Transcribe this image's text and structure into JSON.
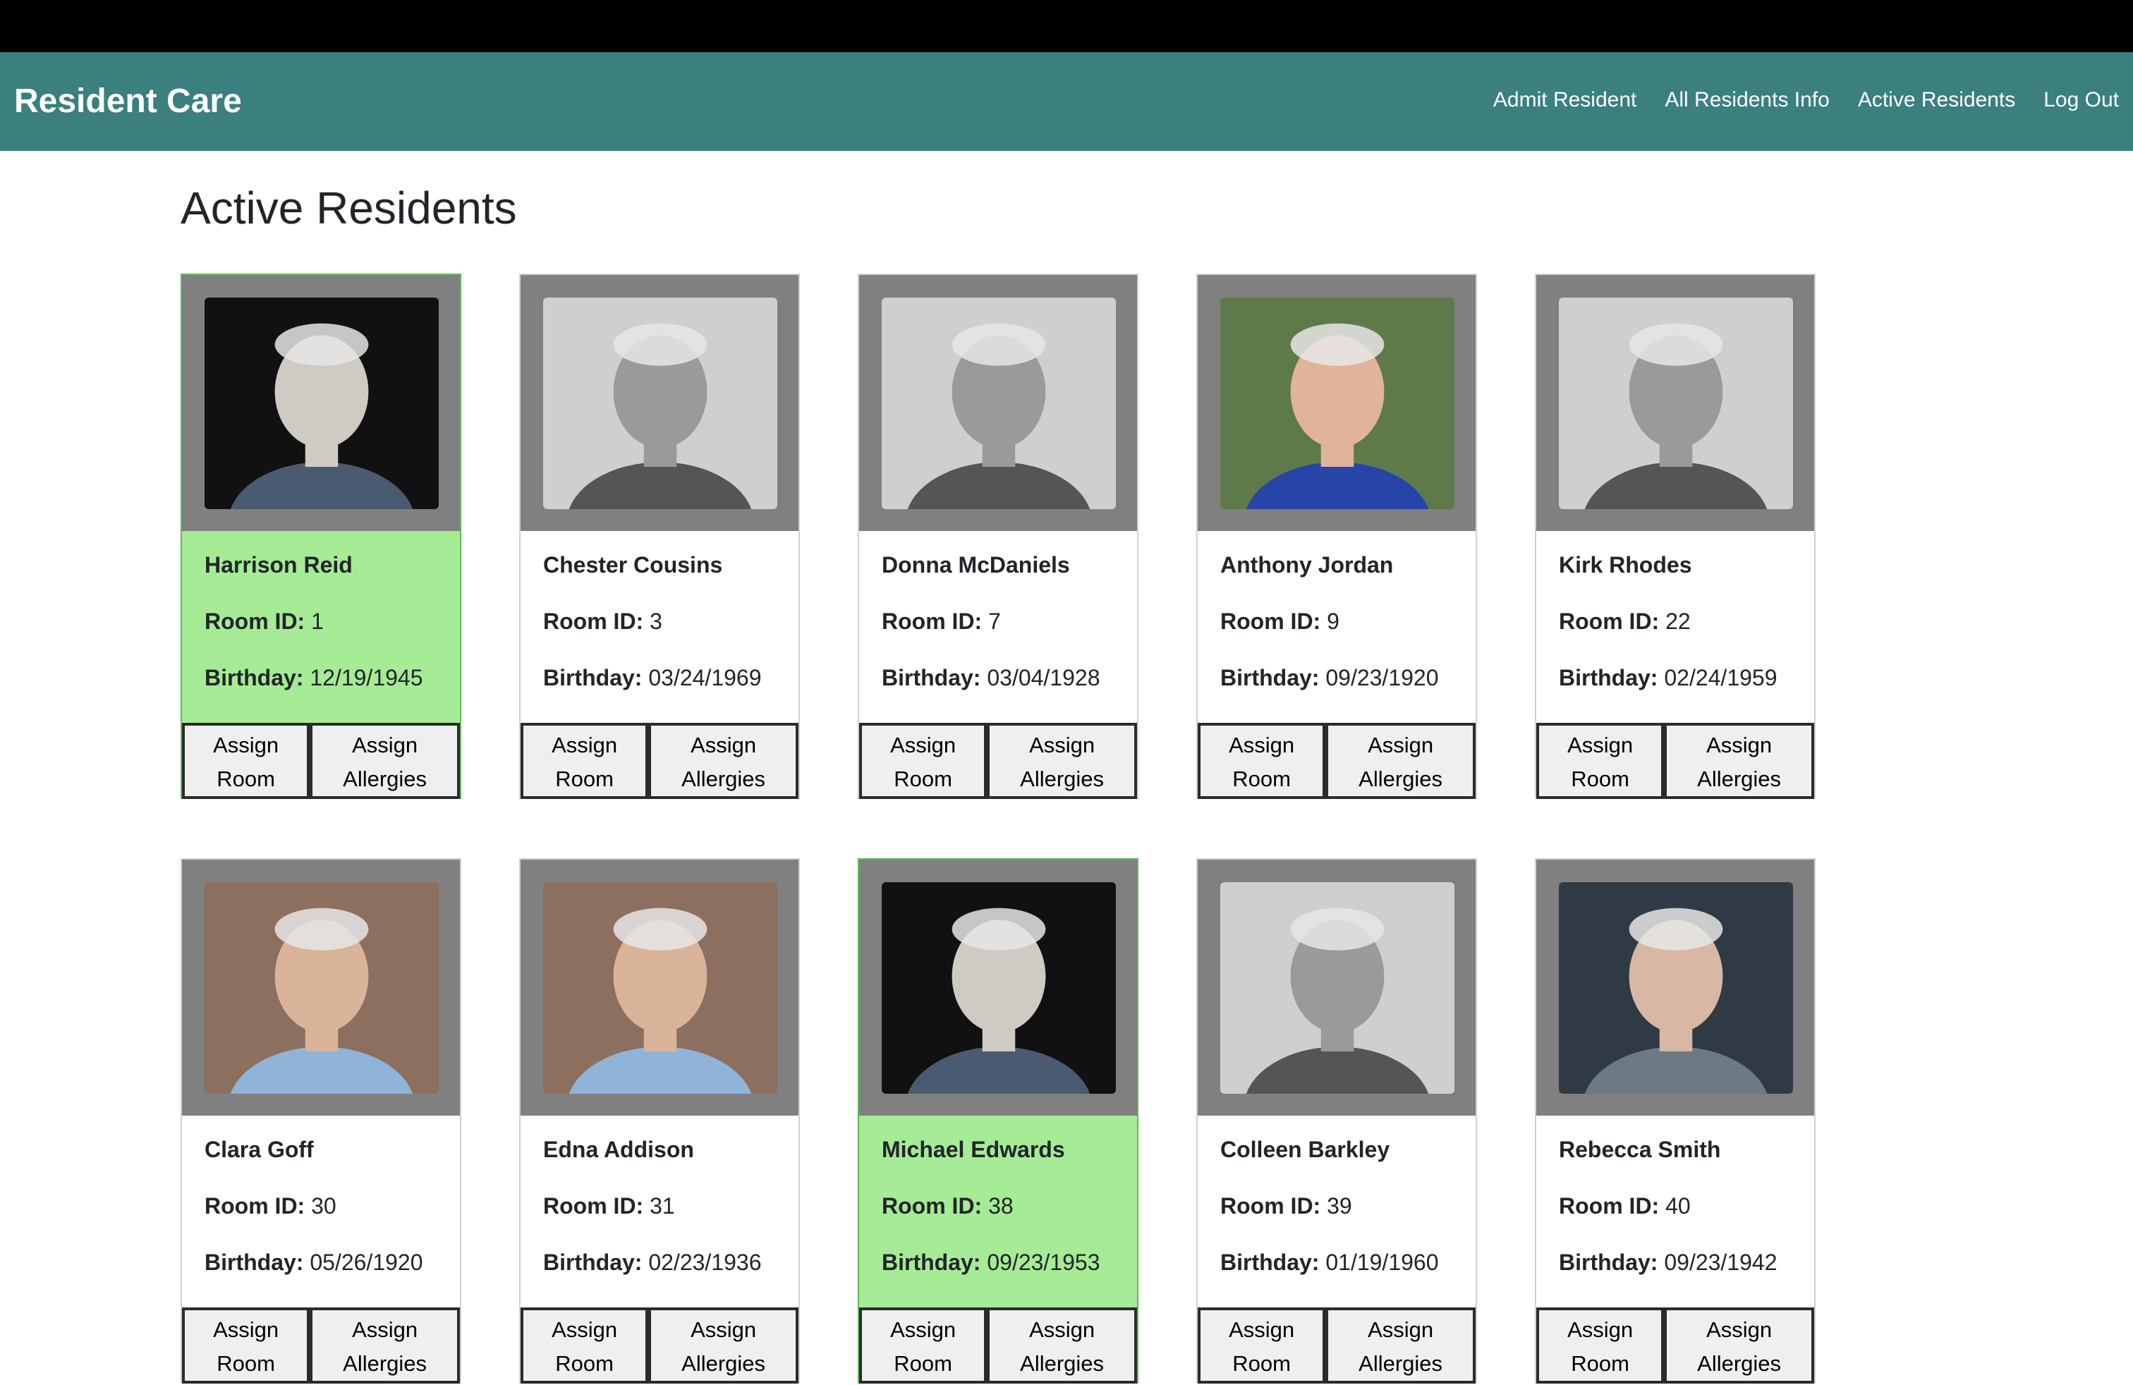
{
  "app": {
    "brand": "Resident Care"
  },
  "nav": {
    "items": [
      {
        "label": "Admit Resident"
      },
      {
        "label": "All Residents Info"
      },
      {
        "label": "Active Residents"
      },
      {
        "label": "Log Out"
      }
    ]
  },
  "page": {
    "title": "Active Residents"
  },
  "labels": {
    "room_id": "Room ID:",
    "birthday": "Birthday:",
    "assign_room": "Assign Room",
    "assign_allergies": "Assign Allergies"
  },
  "colors": {
    "navbar": "#3b7f7f",
    "active_card_bg": "#a6eb95",
    "photo_frame": "#808080"
  },
  "residents": [
    {
      "name": "Harrison Reid",
      "room_id": "1",
      "birthday": "12/19/1945",
      "highlighted": true,
      "photo": "portrait-dark"
    },
    {
      "name": "Chester Cousins",
      "room_id": "3",
      "birthday": "03/24/1969",
      "highlighted": false,
      "photo": "portrait-grey"
    },
    {
      "name": "Donna McDaniels",
      "room_id": "7",
      "birthday": "03/04/1928",
      "highlighted": false,
      "photo": "portrait-grey"
    },
    {
      "name": "Anthony Jordan",
      "room_id": "9",
      "birthday": "09/23/1920",
      "highlighted": false,
      "photo": "portrait-blue"
    },
    {
      "name": "Kirk Rhodes",
      "room_id": "22",
      "birthday": "02/24/1959",
      "highlighted": false,
      "photo": "portrait-grey"
    },
    {
      "name": "Clara Goff",
      "room_id": "30",
      "birthday": "05/26/1920",
      "highlighted": false,
      "photo": "portrait-warm"
    },
    {
      "name": "Edna Addison",
      "room_id": "31",
      "birthday": "02/23/1936",
      "highlighted": false,
      "photo": "portrait-warm"
    },
    {
      "name": "Michael Edwards",
      "room_id": "38",
      "birthday": "09/23/1953",
      "highlighted": true,
      "photo": "portrait-dark"
    },
    {
      "name": "Colleen Barkley",
      "room_id": "39",
      "birthday": "01/19/1960",
      "highlighted": false,
      "photo": "portrait-grey"
    },
    {
      "name": "Rebecca Smith",
      "room_id": "40",
      "birthday": "09/23/1942",
      "highlighted": false,
      "photo": "portrait-cool"
    }
  ]
}
